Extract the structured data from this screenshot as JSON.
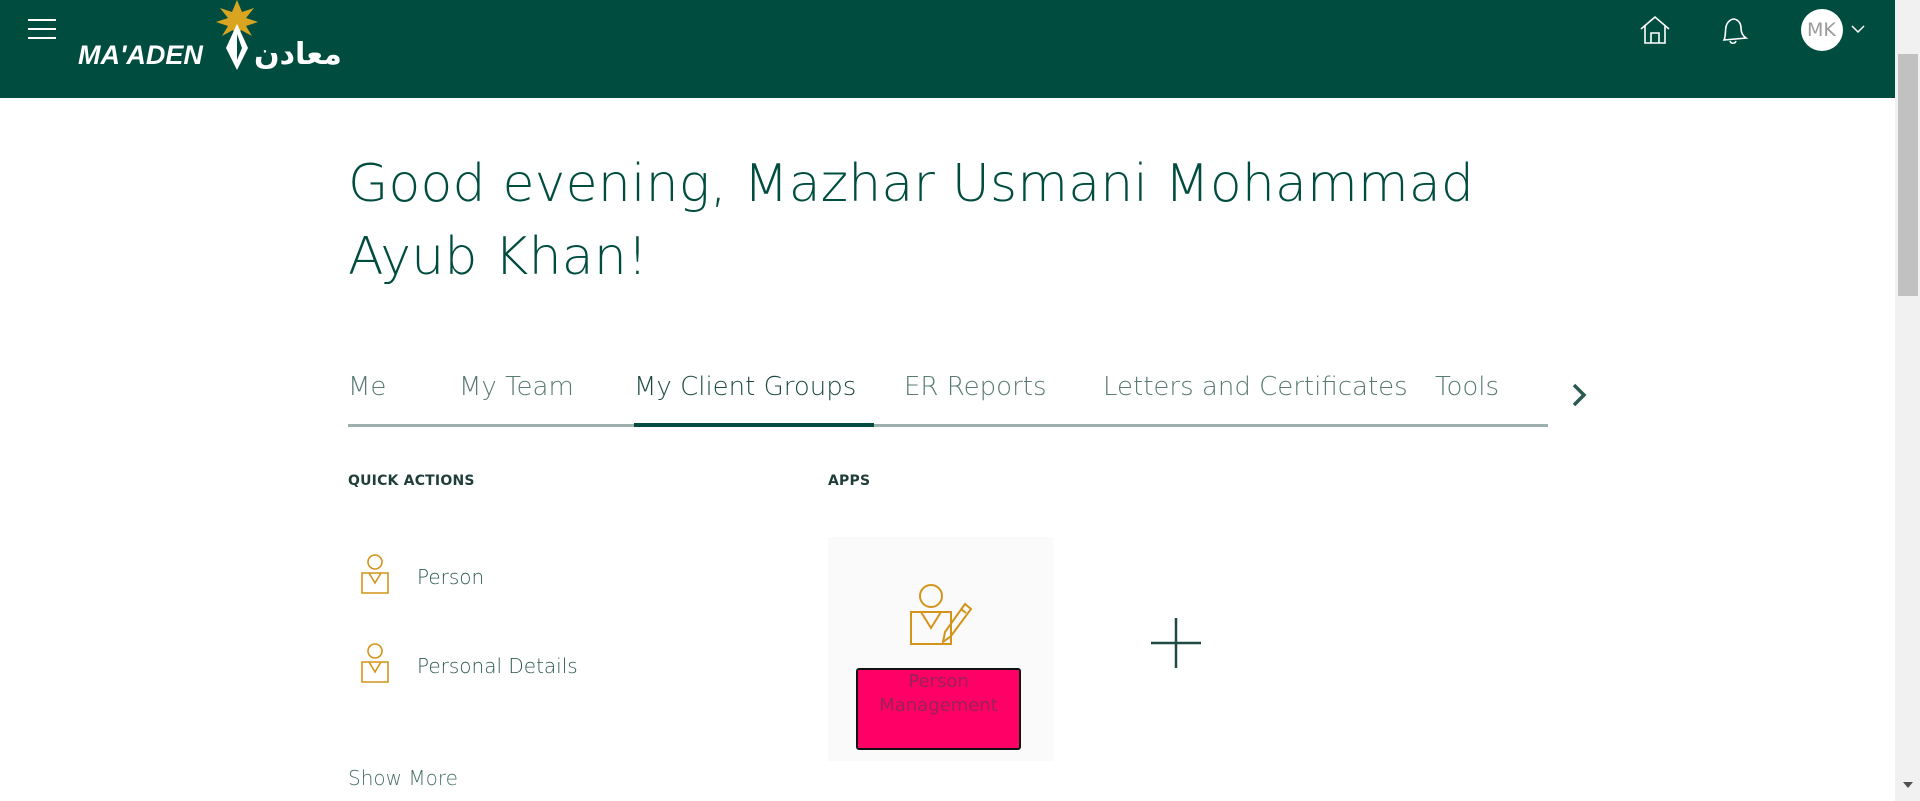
{
  "header": {
    "brand_latin": "MA'ADEN",
    "brand_arabic": "معادن",
    "avatar_initials": "MK",
    "icons": [
      "menu-icon",
      "home-icon",
      "notifications-bell-icon",
      "chevron-down-icon"
    ],
    "colors": {
      "bar": "#004d40",
      "logo_star": "#d9a520"
    }
  },
  "greeting": "Good evening, Mazhar Usmani Mohammad Ayub Khan!",
  "tabs": [
    {
      "label": "Me"
    },
    {
      "label": "My Team"
    },
    {
      "label": "My Client Groups",
      "active": true
    },
    {
      "label": "ER Reports"
    },
    {
      "label": "Letters and Certificates"
    },
    {
      "label": "Tools"
    }
  ],
  "quick_actions": {
    "title": "QUICK ACTIONS",
    "items": [
      {
        "label": "Person",
        "icon": "person-icon"
      },
      {
        "label": "Personal Details",
        "icon": "person-icon"
      }
    ],
    "show_more": "Show More"
  },
  "apps": {
    "title": "APPS",
    "items": [
      {
        "label": "Person Management",
        "icon": "person-edit-icon",
        "highlight": "#ff0066"
      }
    ],
    "add_icon": "plus-icon"
  }
}
